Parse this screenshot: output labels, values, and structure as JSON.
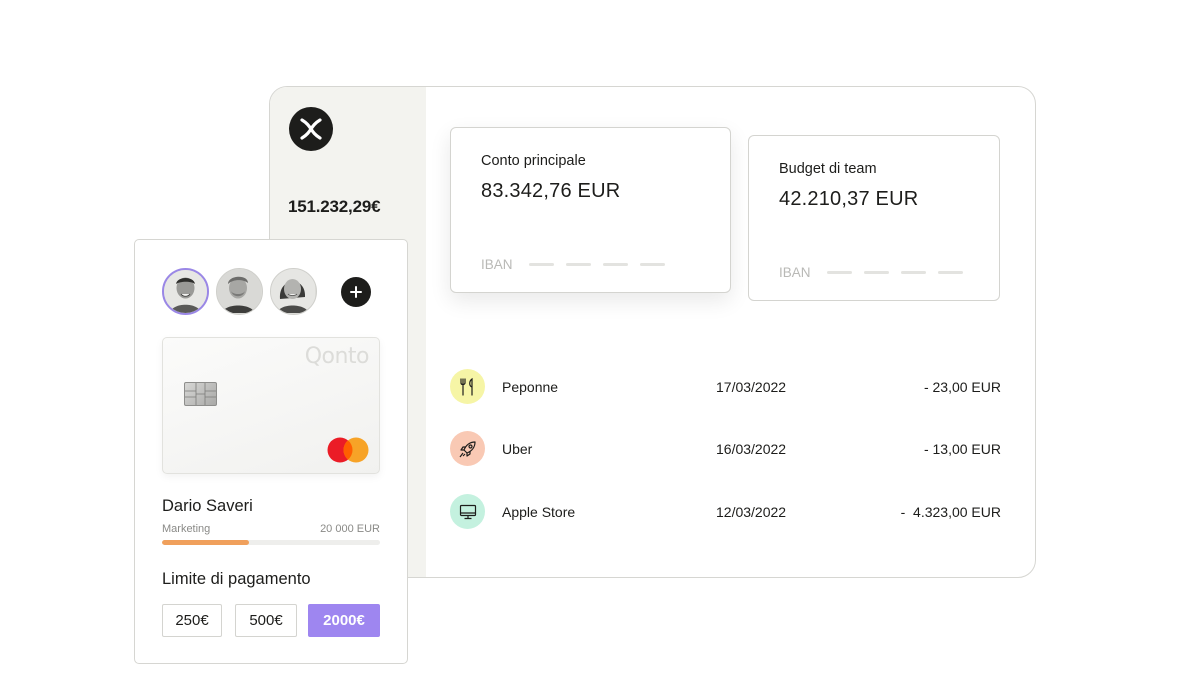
{
  "sidebar": {
    "total_balance": "151.232,29€"
  },
  "accounts": [
    {
      "name": "Conto principale",
      "amount": "83.342,76 EUR",
      "iban_label": "IBAN"
    },
    {
      "name": "Budget di team",
      "amount": "42.210,37 EUR",
      "iban_label": "IBAN"
    }
  ],
  "transactions": [
    {
      "merchant": "Peponne",
      "date": "17/03/2022",
      "amount": "- 23,00 EUR",
      "icon": "fork-knife-icon",
      "icon_bg": "#f6f5a6"
    },
    {
      "merchant": "Uber",
      "date": "16/03/2022",
      "amount": "- 13,00 EUR",
      "icon": "rocket-icon",
      "icon_bg": "#f9c9b4"
    },
    {
      "merchant": "Apple Store",
      "date": "12/03/2022",
      "amount": "-  4.323,00 EUR",
      "icon": "monitor-icon",
      "icon_bg": "#c4f1df"
    }
  ],
  "card": {
    "brand": "Qonto"
  },
  "employee": {
    "name": "Dario Saveri",
    "department": "Marketing",
    "limit": "20 000 EUR",
    "spent_fraction": 0.4
  },
  "payment_limit": {
    "title": "Limite di pagamento",
    "options": [
      "250€",
      "500€",
      "2000€"
    ],
    "selected": "2000€"
  },
  "colors": {
    "accent": "#9e86f0",
    "progress": "#f0a05c",
    "sidebar_bg": "#f3f3ef"
  }
}
